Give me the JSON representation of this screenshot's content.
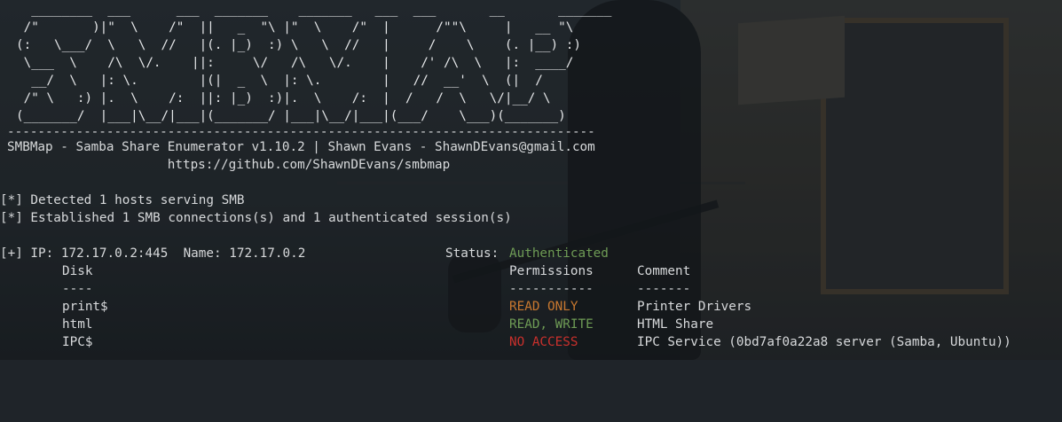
{
  "banner": [
    "  ________  ___      ___  _______    _______   ___  ___       __       _______",
    " /\"       )|\"  \\    /\"  ||   _  \"\\ |\"  \\    /\"  |      /\"\"\\     |   __ \"\\",
    "(:   \\___/  \\   \\  //   |(. |_)  :) \\   \\  //   |     /    \\    (. |__) :)",
    " \\___  \\    /\\  \\/.    ||:     \\/   /\\   \\/.    |    /' /\\  \\   |:  ____/",
    "  __/  \\   |: \\.        |(|  _  \\  |: \\.        |   //  __'  \\  (|  /",
    " /\" \\   :) |.  \\    /:  ||: |_)  :)|.  \\    /:  |  /   /  \\   \\/|__/ \\",
    "(_______/  |___|\\__/|___|(_______/ |___|\\__/|___|(___/    \\___)(_______)"
  ],
  "separator": "-----------------------------------------------------------------------------",
  "title_line": "SMBMap - Samba Share Enumerator v1.10.2 | Shawn Evans - ShawnDEvans@gmail.com",
  "url_line": "                     https://github.com/ShawnDEvans/smbmap",
  "detect_line": "[*] Detected 1 hosts serving SMB",
  "established_line": "[*] Established 1 SMB connections(s) and 1 authenticated session(s)",
  "host": {
    "prefix": "[+] IP: 172.17.0.2:445  Name: 172.17.0.2",
    "status_label": "Status:",
    "status_value": "Authenticated"
  },
  "table": {
    "headers": [
      "Disk",
      "Permissions",
      "Comment"
    ],
    "underlines": [
      "----",
      "-----------",
      "-------"
    ],
    "rows": [
      {
        "disk": "print$",
        "perm": "READ ONLY",
        "comment": "Printer Drivers"
      },
      {
        "disk": "html",
        "perm": "READ, WRITE",
        "comment": "HTML Share"
      },
      {
        "disk": "IPC$",
        "perm": "NO ACCESS",
        "comment": "IPC Service (0bd7af0a22a8 server (Samba, Ubuntu))"
      }
    ]
  },
  "colors": {
    "authenticated": "#6e9b55",
    "read_only": "#c8782f",
    "read_write": "#6e9b55",
    "no_access": "#c9302c"
  }
}
